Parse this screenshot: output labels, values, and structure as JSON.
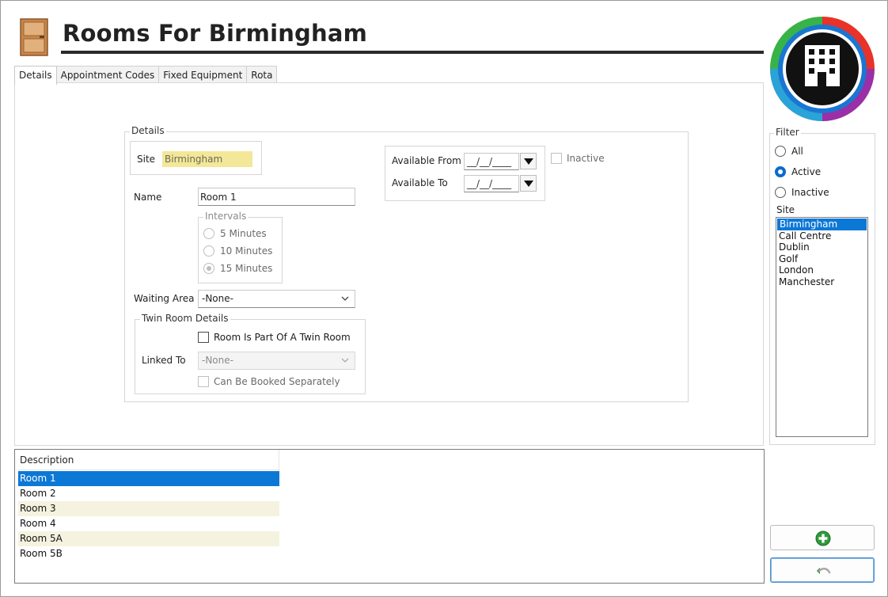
{
  "header": {
    "title": "Rooms For Birmingham"
  },
  "tabs": [
    {
      "label": "Details",
      "active": true
    },
    {
      "label": "Appointment Codes",
      "active": false
    },
    {
      "label": "Fixed Equipment",
      "active": false
    },
    {
      "label": "Rota",
      "active": false
    }
  ],
  "details": {
    "legend": "Details",
    "site_label": "Site",
    "site_value": "Birmingham",
    "name_label": "Name",
    "name_value": "Room 1",
    "intervals": {
      "legend": "Intervals",
      "options": [
        "5 Minutes",
        "10 Minutes",
        "15 Minutes"
      ],
      "selected": "15 Minutes"
    },
    "waiting_area_label": "Waiting Area",
    "waiting_area_value": "-None-",
    "availability": {
      "from_label": "Available From",
      "to_label": "Available To",
      "from_value": "__/__/____",
      "to_value": "__/__/____"
    },
    "inactive_label": "Inactive",
    "twin": {
      "legend": "Twin Room Details",
      "part_of_twin_label": "Room Is Part Of A Twin Room",
      "linked_to_label": "Linked To",
      "linked_to_value": "-None-",
      "booked_separately_label": "Can Be Booked Separately"
    }
  },
  "grid": {
    "column": "Description",
    "rows": [
      "Room 1",
      "Room 2",
      "Room 3",
      "Room 4",
      "Room 5A",
      "Room 5B"
    ],
    "selected": "Room 1"
  },
  "filter": {
    "legend": "Filter",
    "options": [
      "All",
      "Active",
      "Inactive"
    ],
    "selected": "Active",
    "site_label": "Site",
    "sites": [
      "Birmingham",
      "Call Centre",
      "Dublin",
      "Golf",
      "London",
      "Manchester"
    ],
    "selected_site": "Birmingham"
  },
  "colors": {
    "accent": "#0c78d6",
    "site_field_bg": "#f3e79a",
    "row_alt": "#f5f3df",
    "add_icon": "#2e9b3a"
  },
  "icons": {
    "header": "door-icon",
    "logo": "building-logo-icon",
    "add": "add-circle-icon",
    "undo": "undo-icon"
  }
}
